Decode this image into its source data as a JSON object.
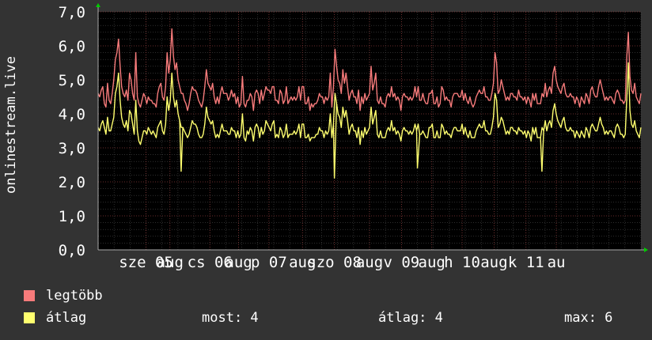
{
  "chart_data": {
    "type": "line",
    "ylabel": "onlinestream.live",
    "yticks": [
      "0,0",
      "1,0",
      "2,0",
      "3,0",
      "4,0",
      "5,0",
      "6,0",
      "7,0"
    ],
    "ylim": [
      0,
      7
    ],
    "xlim": [
      0,
      340
    ],
    "xticks": [
      {
        "label": "sze 05",
        "x": 30
      },
      {
        "label": "aug",
        "x": 45
      },
      {
        "label": "cs 06",
        "x": 70
      },
      {
        "label": "aug",
        "x": 88
      },
      {
        "label": "p 07",
        "x": 107
      },
      {
        "label": "aug",
        "x": 128
      },
      {
        "label": "szo 08",
        "x": 148
      },
      {
        "label": "aug",
        "x": 170
      },
      {
        "label": "v 09",
        "x": 190
      },
      {
        "label": "aug",
        "x": 209
      },
      {
        "label": "h 10",
        "x": 228
      },
      {
        "label": "aug",
        "x": 248
      },
      {
        "label": "k 11",
        "x": 268
      },
      {
        "label": "au",
        "x": 287
      }
    ],
    "grid": true,
    "colors": {
      "max": "#f77b7b",
      "avg": "#ffff6f",
      "grid_major": "#8a3a3a",
      "grid_minor": "#4a4a4a",
      "axis": "#aaaaaa",
      "arrow": "#00cc00"
    },
    "series": [
      {
        "name": "legtöbb",
        "color": "#f77b7b",
        "values": [
          4.6,
          4.5,
          4.7,
          4.8,
          4.3,
          4.2,
          4.9,
          4.4,
          4.3,
          4.6,
          5.0,
          5.6,
          5.8,
          6.2,
          5.4,
          4.8,
          4.6,
          4.5,
          4.7,
          4.4,
          5.2,
          5.0,
          4.6,
          4.4,
          5.8,
          4.5,
          4.3,
          4.2,
          4.4,
          4.6,
          4.5,
          4.3,
          4.5,
          4.4,
          4.4,
          4.3,
          4.3,
          4.2,
          4.6,
          4.8,
          4.9,
          4.5,
          4.4,
          4.8,
          5.8,
          5.2,
          5.6,
          6.5,
          5.7,
          5.3,
          5.5,
          5.0,
          4.8,
          4.6,
          4.6,
          4.4,
          4.3,
          4.1,
          4.3,
          4.6,
          4.8,
          4.7,
          4.7,
          4.6,
          4.4,
          4.3,
          4.2,
          4.4,
          4.8,
          5.3,
          4.9,
          4.8,
          4.7,
          4.9,
          4.5,
          4.3,
          4.5,
          4.3,
          4.6,
          4.8,
          4.6,
          4.6,
          4.6,
          4.4,
          4.5,
          4.7,
          4.5,
          4.6,
          4.3,
          4.5,
          4.2,
          4.3,
          5.1,
          4.3,
          4.2,
          4.4,
          4.4,
          4.6,
          4.5,
          4.1,
          4.6,
          4.7,
          4.6,
          4.3,
          4.7,
          4.4,
          4.6,
          4.8,
          4.7,
          4.7,
          4.6,
          4.8,
          4.8,
          4.4,
          4.4,
          4.3,
          4.7,
          4.6,
          4.3,
          4.4,
          4.8,
          4.3,
          4.4,
          4.5,
          4.4,
          4.5,
          4.4,
          4.5,
          4.8,
          4.4,
          4.8,
          4.8,
          4.3,
          4.3,
          4.5,
          4.1,
          4.3,
          4.2,
          4.3,
          4.3,
          4.4,
          4.6,
          4.5,
          4.5,
          4.3,
          4.5,
          4.4,
          4.5,
          5.2,
          4.2,
          4.8,
          5.9,
          5.4,
          5.0,
          4.9,
          4.6,
          5.3,
          4.9,
          5.2,
          4.8,
          4.4,
          4.6,
          4.7,
          4.5,
          4.5,
          4.3,
          4.7,
          4.1,
          4.5,
          4.3,
          4.6,
          4.4,
          4.5,
          4.6,
          5.4,
          4.7,
          4.9,
          5.2,
          4.4,
          4.3,
          4.5,
          4.3,
          4.3,
          4.2,
          4.5,
          4.6,
          4.5,
          4.8,
          4.5,
          4.6,
          4.4,
          4.5,
          4.4,
          4.1,
          4.5,
          4.6,
          4.5,
          4.5,
          4.4,
          4.5,
          4.4,
          4.5,
          4.8,
          4.5,
          4.8,
          4.4,
          4.4,
          4.6,
          4.4,
          4.3,
          4.3,
          4.6,
          4.6,
          4.7,
          4.3,
          4.3,
          4.5,
          4.2,
          4.3,
          4.8,
          4.7,
          4.4,
          4.5,
          4.4,
          4.4,
          4.2,
          4.5,
          4.6,
          4.6,
          4.6,
          4.5,
          4.5,
          4.7,
          4.4,
          4.6,
          4.4,
          4.3,
          4.5,
          4.3,
          4.2,
          4.3,
          4.5,
          4.6,
          4.7,
          4.6,
          4.6,
          4.8,
          4.5,
          4.5,
          4.4,
          4.4,
          4.6,
          4.9,
          5.8,
          5.5,
          4.6,
          4.7,
          5.0,
          4.8,
          4.6,
          4.4,
          4.5,
          4.4,
          4.6,
          4.6,
          4.5,
          4.5,
          4.4,
          4.7,
          4.5,
          4.5,
          4.4,
          4.5,
          4.3,
          4.5,
          4.4,
          4.2,
          4.6,
          4.4,
          4.6,
          4.3,
          4.3,
          4.3,
          4.6,
          4.5,
          4.9,
          4.5,
          4.7,
          4.8,
          4.6,
          5.2,
          5.4,
          5.0,
          4.8,
          4.7,
          4.6,
          4.8,
          4.9,
          4.6,
          4.5,
          4.5,
          4.6,
          4.5,
          4.5,
          4.3,
          4.5,
          4.4,
          4.2,
          4.5,
          4.4,
          4.3,
          4.6,
          4.5,
          4.3,
          4.7,
          4.8,
          4.6,
          4.5,
          4.5,
          4.8,
          5.0,
          4.8,
          4.6,
          4.4,
          4.5,
          4.4,
          4.5,
          4.5,
          4.4,
          4.3,
          4.6,
          4.7,
          4.6,
          4.4,
          4.4,
          4.3,
          4.4,
          5.7,
          6.4,
          5.1,
          4.7,
          4.6,
          4.9,
          4.5,
          4.4,
          4.3,
          4.6
        ]
      },
      {
        "name": "átlag",
        "color": "#ffff6f",
        "values": [
          3.6,
          3.5,
          3.7,
          3.8,
          3.6,
          3.4,
          3.9,
          3.5,
          3.5,
          3.7,
          3.9,
          4.6,
          4.8,
          5.2,
          4.4,
          3.9,
          3.7,
          3.6,
          3.8,
          3.5,
          4.1,
          4.0,
          3.7,
          3.4,
          4.4,
          3.5,
          3.2,
          3.1,
          3.3,
          3.5,
          3.5,
          3.4,
          3.6,
          3.5,
          3.4,
          3.5,
          3.4,
          3.3,
          3.6,
          3.7,
          3.8,
          3.5,
          3.4,
          3.7,
          4.5,
          4.1,
          4.4,
          5.2,
          4.5,
          4.2,
          4.4,
          4.0,
          3.8,
          3.6,
          3.6,
          3.5,
          3.4,
          3.3,
          3.4,
          3.6,
          3.8,
          3.7,
          3.7,
          3.6,
          3.4,
          3.3,
          3.3,
          3.4,
          3.7,
          4.2,
          3.9,
          3.8,
          3.7,
          3.8,
          3.5,
          3.3,
          3.4,
          3.3,
          3.5,
          3.7,
          3.5,
          3.5,
          3.5,
          3.4,
          3.4,
          3.6,
          3.5,
          3.5,
          3.3,
          3.5,
          3.3,
          3.4,
          4.0,
          3.3,
          3.2,
          3.5,
          3.4,
          3.6,
          3.5,
          3.2,
          3.6,
          3.7,
          3.6,
          3.3,
          3.6,
          3.4,
          3.5,
          3.8,
          3.7,
          3.6,
          3.5,
          3.7,
          3.8,
          3.3,
          3.4,
          3.3,
          3.6,
          3.5,
          3.3,
          3.4,
          3.7,
          3.3,
          3.4,
          3.4,
          3.4,
          3.5,
          3.4,
          3.5,
          3.7,
          3.3,
          3.7,
          3.7,
          3.3,
          3.3,
          3.4,
          3.2,
          3.3,
          3.3,
          3.3,
          3.4,
          3.4,
          3.6,
          3.5,
          3.5,
          3.3,
          3.5,
          3.4,
          3.5,
          4.0,
          3.3,
          3.7,
          4.6,
          4.3,
          4.0,
          3.9,
          3.6,
          4.2,
          3.9,
          4.1,
          3.8,
          3.4,
          3.6,
          3.7,
          3.5,
          3.5,
          3.3,
          3.6,
          3.1,
          3.5,
          3.3,
          3.6,
          3.4,
          3.5,
          3.6,
          4.2,
          3.7,
          3.9,
          4.1,
          3.4,
          3.3,
          3.5,
          3.3,
          3.3,
          3.3,
          3.5,
          3.6,
          3.5,
          3.8,
          3.5,
          3.6,
          3.4,
          3.5,
          3.4,
          3.2,
          3.5,
          3.6,
          3.5,
          3.5,
          3.4,
          3.5,
          3.4,
          3.5,
          3.7,
          3.5,
          3.7,
          3.4,
          3.4,
          3.5,
          3.4,
          3.3,
          3.3,
          3.6,
          3.6,
          3.7,
          3.3,
          3.3,
          3.5,
          3.3,
          3.3,
          3.7,
          3.6,
          3.4,
          3.5,
          3.4,
          3.4,
          3.3,
          3.5,
          3.6,
          3.6,
          3.5,
          3.5,
          3.5,
          3.7,
          3.4,
          3.6,
          3.4,
          3.3,
          3.5,
          3.3,
          3.3,
          3.3,
          3.5,
          3.6,
          3.7,
          3.6,
          3.6,
          3.8,
          3.5,
          3.5,
          3.4,
          3.4,
          3.6,
          3.9,
          4.6,
          4.4,
          3.6,
          3.7,
          3.9,
          3.8,
          3.6,
          3.4,
          3.5,
          3.4,
          3.6,
          3.6,
          3.5,
          3.5,
          3.4,
          3.6,
          3.5,
          3.5,
          3.4,
          3.5,
          3.3,
          3.5,
          3.4,
          3.2,
          3.6,
          3.4,
          3.6,
          3.3,
          3.3,
          3.3,
          3.6,
          3.5,
          3.8,
          3.5,
          3.7,
          3.8,
          3.6,
          4.1,
          4.3,
          4.0,
          3.8,
          3.7,
          3.6,
          3.8,
          3.9,
          3.6,
          3.5,
          3.5,
          3.6,
          3.5,
          3.5,
          3.3,
          3.5,
          3.4,
          3.3,
          3.5,
          3.4,
          3.3,
          3.6,
          3.5,
          3.3,
          3.6,
          3.7,
          3.6,
          3.5,
          3.5,
          3.7,
          3.9,
          3.7,
          3.6,
          3.4,
          3.5,
          3.4,
          3.5,
          3.5,
          3.4,
          3.3,
          3.6,
          3.7,
          3.6,
          3.4,
          3.4,
          3.3,
          3.4,
          4.5,
          5.5,
          4.1,
          3.7,
          3.6,
          3.8,
          3.5,
          3.4,
          3.3,
          3.6
        ]
      }
    ],
    "dips": [
      {
        "x": 52,
        "value": 2.3
      },
      {
        "x": 148,
        "value": 2.1
      },
      {
        "x": 200,
        "value": 2.4
      },
      {
        "x": 278,
        "value": 2.3
      }
    ]
  },
  "legend": [
    {
      "label": "legtöbb",
      "color": "#f77b7b"
    },
    {
      "label": "átlag",
      "color": "#ffff6f"
    }
  ],
  "stats": {
    "now": "most: 4",
    "avg": "átlag: 4",
    "max": "max: 6"
  }
}
